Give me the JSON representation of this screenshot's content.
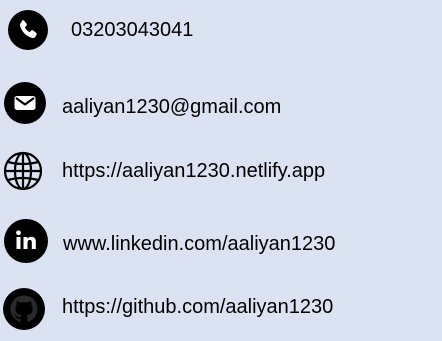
{
  "contacts": [
    {
      "icon": "phone-icon",
      "text": "03203043041"
    },
    {
      "icon": "email-icon",
      "text": "aaliyan1230@gmail.com"
    },
    {
      "icon": "globe-icon",
      "text": "https://aaliyan1230.netlify.app"
    },
    {
      "icon": "linkedin-icon",
      "text": "www.linkedin.com/aaliyan1230"
    },
    {
      "icon": "github-icon",
      "text": "https://github.com/aaliyan1230"
    }
  ],
  "colors": {
    "background": "#dbe3f3",
    "icon": "#000000",
    "text": "#000000"
  }
}
